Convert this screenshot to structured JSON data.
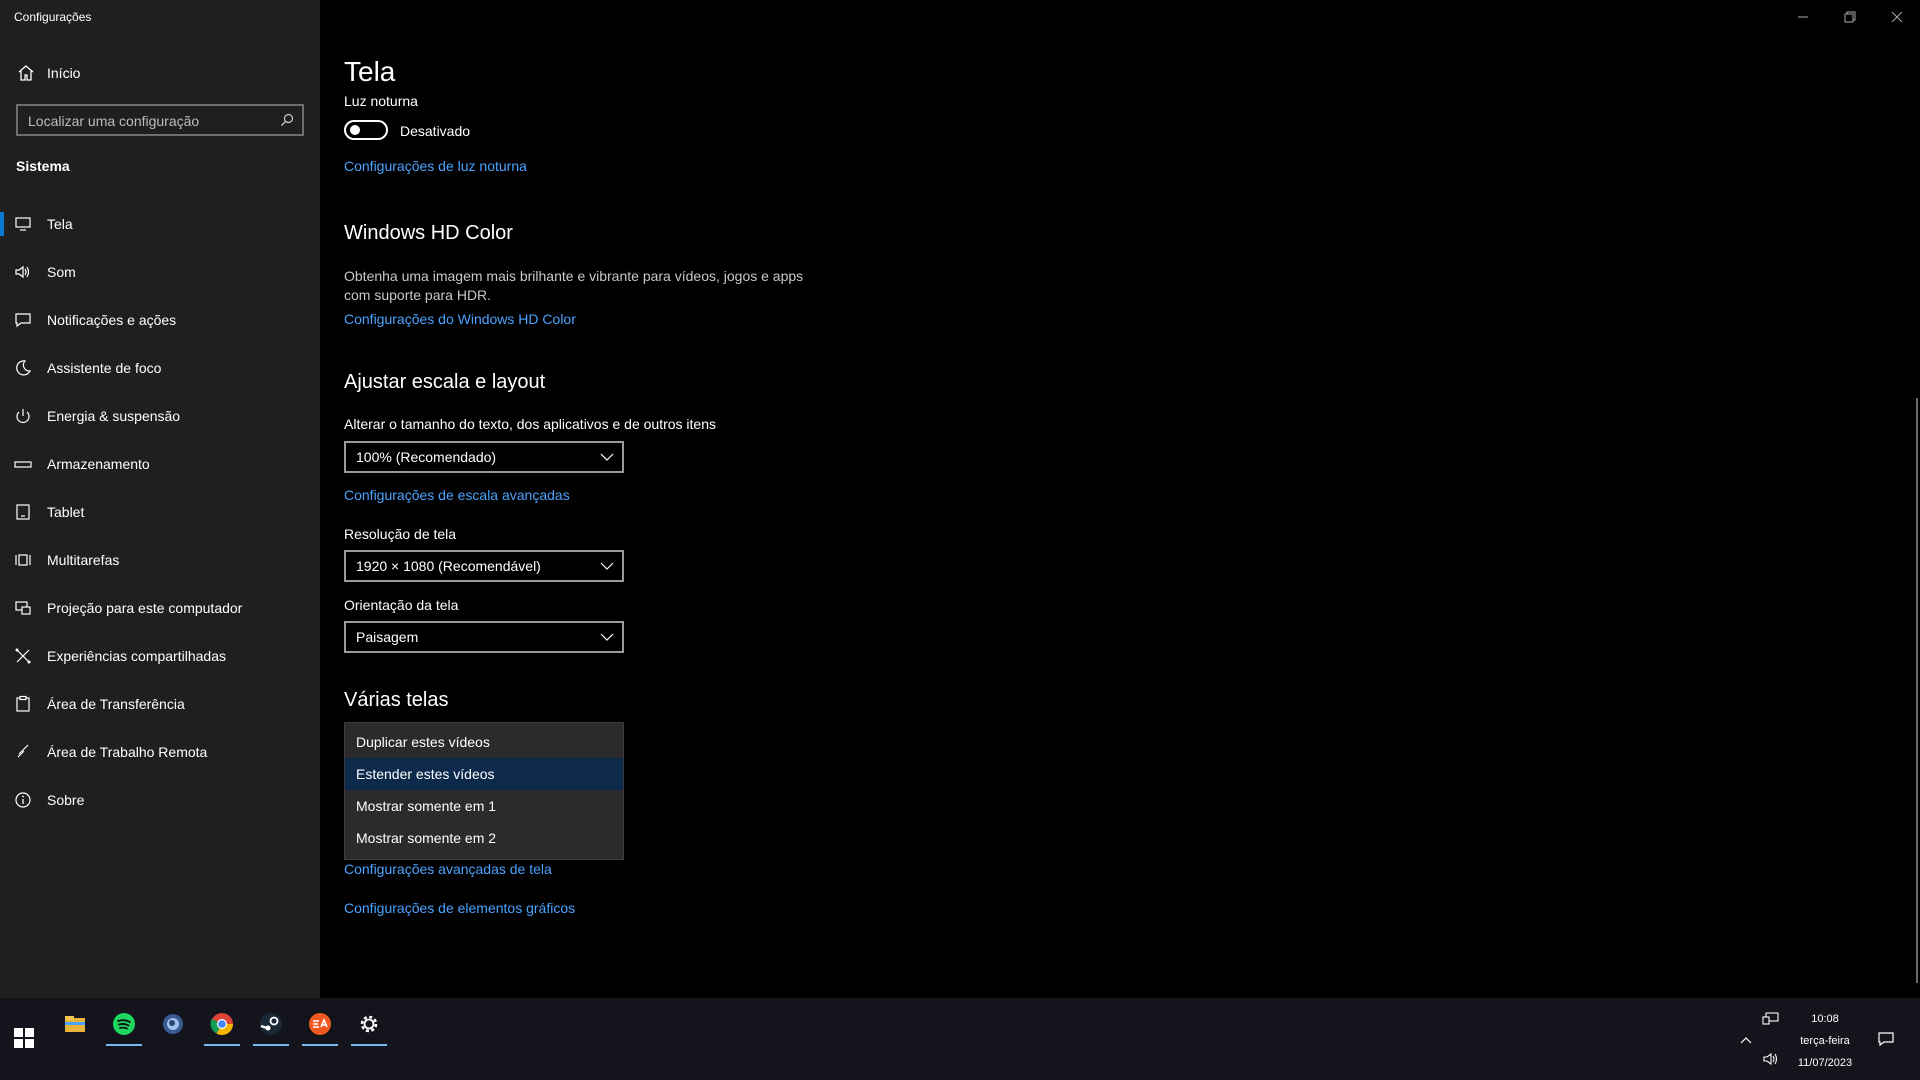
{
  "app": {
    "title": "Configurações"
  },
  "sidebar": {
    "home_label": "Início",
    "search_placeholder": "Localizar uma configuração",
    "section_title": "Sistema",
    "items": [
      {
        "label": "Tela",
        "icon": "monitor-icon",
        "active": true
      },
      {
        "label": "Som",
        "icon": "speaker-icon",
        "active": false
      },
      {
        "label": "Notificações e ações",
        "icon": "notification-icon",
        "active": false
      },
      {
        "label": "Assistente de foco",
        "icon": "moon-icon",
        "active": false
      },
      {
        "label": "Energia & suspensão",
        "icon": "power-icon",
        "active": false
      },
      {
        "label": "Armazenamento",
        "icon": "storage-icon",
        "active": false
      },
      {
        "label": "Tablet",
        "icon": "tablet-icon",
        "active": false
      },
      {
        "label": "Multitarefas",
        "icon": "multitask-icon",
        "active": false
      },
      {
        "label": "Projeção para este computador",
        "icon": "projection-icon",
        "active": false
      },
      {
        "label": "Experiências compartilhadas",
        "icon": "shared-icon",
        "active": false
      },
      {
        "label": "Área de Transferência",
        "icon": "clipboard-icon",
        "active": false
      },
      {
        "label": "Área de Trabalho Remota",
        "icon": "remote-icon",
        "active": false
      },
      {
        "label": "Sobre",
        "icon": "info-icon",
        "active": false
      }
    ]
  },
  "main": {
    "title": "Tela",
    "night_light": {
      "label": "Luz noturna",
      "state_text": "Desativado",
      "link": "Configurações de luz noturna"
    },
    "hdr": {
      "heading": "Windows HD Color",
      "description": "Obtenha uma imagem mais brilhante e vibrante para vídeos, jogos e apps com suporte para HDR.",
      "link": "Configurações do Windows HD Color"
    },
    "scale": {
      "heading": "Ajustar escala e layout",
      "size_label": "Alterar o tamanho do texto, dos aplicativos e de outros itens",
      "size_value": "100% (Recomendado)",
      "advanced_link": "Configurações de escala avançadas",
      "resolution_label": "Resolução de tela",
      "resolution_value": "1920 × 1080 (Recomendável)",
      "orientation_label": "Orientação da tela",
      "orientation_value": "Paisagem"
    },
    "multi": {
      "heading": "Várias telas",
      "options": [
        "Duplicar estes vídeos",
        "Estender estes vídeos",
        "Mostrar somente em 1",
        "Mostrar somente em 2"
      ],
      "selected_index": 1,
      "advanced_display_link": "Configurações avançadas de tela",
      "graphics_link": "Configurações de elementos gráficos"
    }
  },
  "taskbar": {
    "apps": [
      "file-explorer-icon",
      "spotify-icon",
      "app-circle-icon",
      "chrome-icon",
      "steam-icon",
      "ea-icon",
      "settings-gear-icon"
    ],
    "time": "10:08",
    "weekday": "terça-feira",
    "date": "11/07/2023"
  },
  "colors": {
    "accent": "#0a78d4",
    "link": "#4aa3ff",
    "sidebar_bg": "#1f1f1f",
    "dropdown_selected": "#0d2a4d"
  }
}
